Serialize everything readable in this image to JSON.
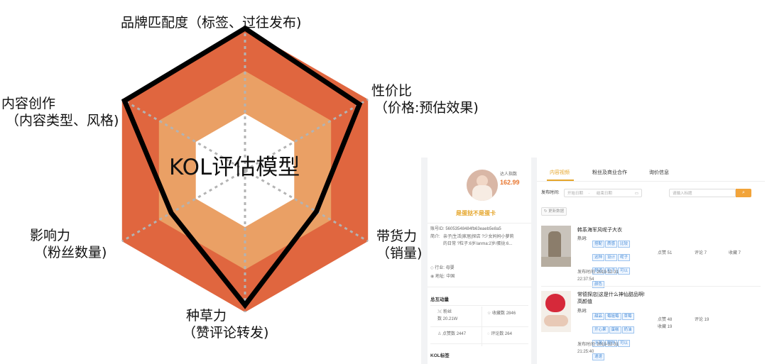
{
  "diagram": {
    "center_title": "KOL评估模型",
    "axes": [
      {
        "lines": [
          "品牌匹配度（标签、过往发布)"
        ]
      },
      {
        "lines": [
          "性价比",
          "（价格:预估效果)"
        ]
      },
      {
        "lines": [
          "带货力",
          "（销量)"
        ]
      },
      {
        "lines": [
          "种草力",
          "（赞评论转发)"
        ]
      },
      {
        "lines": [
          "影响力",
          "（粉丝数量)"
        ]
      },
      {
        "lines": [
          "内容创作",
          "（内容类型、风格)"
        ]
      }
    ],
    "score_levels": [
      1.0,
      0.93,
      0.58,
      0.95,
      0.6,
      0.98
    ],
    "colors": {
      "outer_ring": "#e0663f",
      "middle_ring": "#eaa065",
      "inner": "#ffffff",
      "score_line": "#000000",
      "grid_dots": "#b3b3b3"
    }
  },
  "screenshot": {
    "profile": {
      "index_label": "达人指数",
      "index_value": "162.99",
      "name": "是蛋挞不是蛋卡",
      "account_id": "账号ID:  56053548484fb63eaeb5e8a5",
      "intro_label": "简介:",
      "intro_line1": "亲子|生活|家居|探店 ?少女妈妈小萝莉",
      "intro_line2": "的日常 ?粒子:6岁/anma:2岁/蛋挞:6...",
      "industry": "行业:   母婴",
      "region": "地址:   中国",
      "interaction_title": "总互动量",
      "fans_label": "粉丝",
      "fans_value": "数 20.21W",
      "favorites": "收藏数 2846",
      "likes": "点赞数 2447",
      "comments": "评论数 264",
      "kol_tags": "KOL标签"
    },
    "tabs": [
      "内容视频",
      "粉丝及商业合作",
      "询价信息"
    ],
    "filter": {
      "time_label": "发布时间:",
      "start_placeholder": "开始日期",
      "end_placeholder": "结束日期",
      "search_placeholder": "请输入标题",
      "refresh_label": "更新数据"
    },
    "posts": [
      {
        "title": "韩系海军风呢子大衣",
        "hot_label": "热词:",
        "tags": [
          "搭配",
          "质感",
          "比较",
          "这种",
          "设计",
          "呢子",
          "舒适",
          "粒子",
          "可以",
          "颜色"
        ],
        "likes": "点赞 51",
        "comments": "评论 7",
        "favorites": "收藏 7",
        "time_label": "发布时间:  2019-12-31",
        "time_value": "22:37:54"
      },
      {
        "title": "常德探店|这是什么神仙甜品啊!",
        "title2": "高颜值",
        "hot_label": "热词:",
        "tags": [
          "甜品",
          "莓姐莓",
          "草莓",
          "开心果",
          "蛋糕",
          "奶油",
          "冰激",
          "酸种",
          "可以",
          "速速"
        ],
        "likes": "点赞 48",
        "comments": "评论 19",
        "favorites": "收藏 19",
        "time_label": "发布时间:  2019-12-31",
        "time_value": "21:25:40"
      }
    ]
  }
}
